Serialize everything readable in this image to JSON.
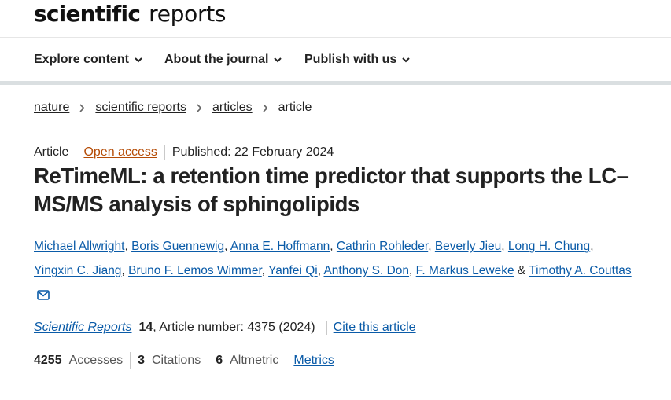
{
  "header": {
    "logo_bold": "scientific",
    "logo_light": "reports"
  },
  "nav": {
    "items": [
      {
        "label": "Explore content"
      },
      {
        "label": "About the journal"
      },
      {
        "label": "Publish with us"
      }
    ]
  },
  "breadcrumb": {
    "items": [
      "nature",
      "scientific reports",
      "articles"
    ],
    "current": "article"
  },
  "article": {
    "type": "Article",
    "access": "Open access",
    "published": "Published: 22 February 2024",
    "title": "ReTimeML: a retention time predictor that supports the LC–MS/MS analysis of sphingolipids",
    "authors": [
      "Michael Allwright",
      "Boris Guennewig",
      "Anna E. Hoffmann",
      "Cathrin Rohleder",
      "Beverly Jieu",
      "Long H. Chung",
      "Yingxin C. Jiang",
      "Bruno F. Lemos Wimmer",
      "Yanfei Qi",
      "Anthony S. Don",
      "F. Markus Leweke",
      "Timothy A. Couttas"
    ],
    "author_ampersand": "&",
    "mail_icon": "envelope-icon"
  },
  "citation": {
    "journal": "Scientific Reports",
    "volume": "14",
    "article_number": ", Article number: 4375 (2024)",
    "cite_label": "Cite this article"
  },
  "metrics": {
    "accesses_value": "4255",
    "accesses_label": "Accesses",
    "citations_value": "3",
    "citations_label": "Citations",
    "altmetric_value": "6",
    "altmetric_label": "Altmetric",
    "metrics_link": "Metrics"
  },
  "colors": {
    "link": "#0a5ba8",
    "open_access": "#b54c06",
    "text": "#222222"
  }
}
